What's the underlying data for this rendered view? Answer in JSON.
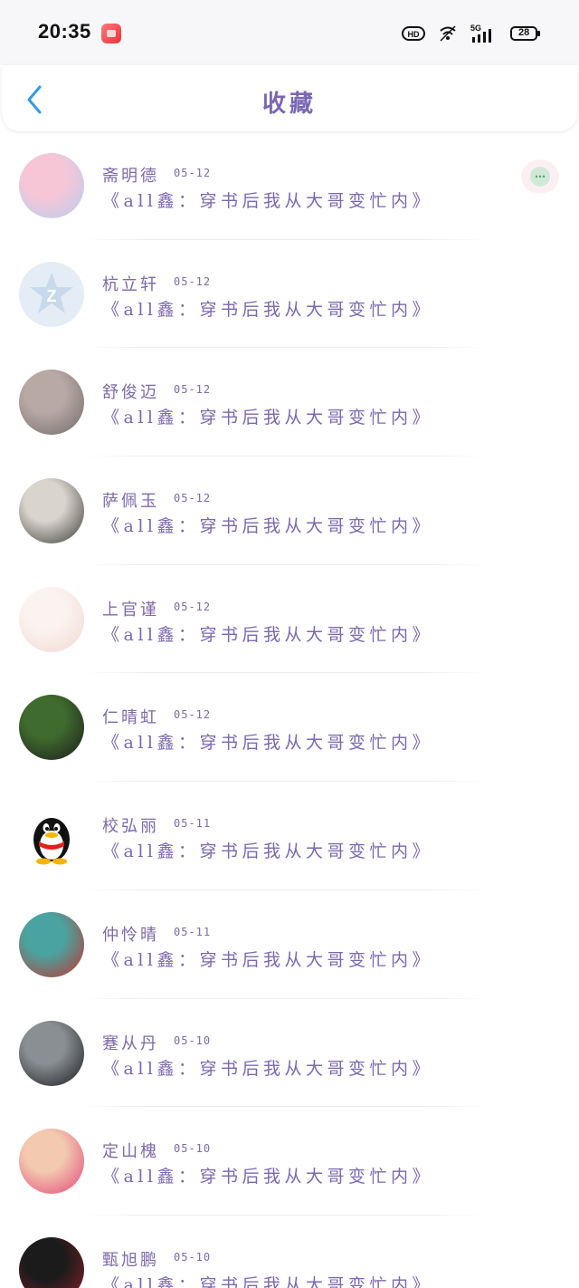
{
  "status_bar": {
    "time": "20:35",
    "battery": "28",
    "icons": [
      "app-icon",
      "hd-icon",
      "signal-icon",
      "network-5g-icon",
      "battery-icon"
    ]
  },
  "header": {
    "title": "收藏",
    "back_icon": "chevron-left-icon"
  },
  "floating_button": {
    "icon": "more-dots-icon",
    "label": "⋯"
  },
  "items": [
    {
      "name": "斋明德",
      "date": "05-12",
      "title": "《all鑫：穿书后我从大哥变忙内》",
      "avatar": {
        "kind": "photo",
        "colors": [
          "#f7c6d6",
          "#b9cdef"
        ]
      }
    },
    {
      "name": "杭立轩",
      "date": "05-12",
      "title": "《all鑫：穿书后我从大哥变忙内》",
      "avatar": {
        "kind": "badge",
        "icon": "z-star-badge-icon",
        "colors": [
          "#dbe7f4",
          "#eef3f9"
        ]
      }
    },
    {
      "name": "舒俊迈",
      "date": "05-12",
      "title": "《all鑫：穿书后我从大哥变忙内》",
      "avatar": {
        "kind": "photo",
        "colors": [
          "#b9a9a5",
          "#6f6a6a"
        ]
      }
    },
    {
      "name": "萨佩玉",
      "date": "05-12",
      "title": "《all鑫：穿书后我从大哥变忙内》",
      "avatar": {
        "kind": "photo",
        "colors": [
          "#d9d4cc",
          "#3a3a38"
        ]
      }
    },
    {
      "name": "上官谨",
      "date": "05-12",
      "title": "《all鑫：穿书后我从大哥变忙内》",
      "avatar": {
        "kind": "photo",
        "colors": [
          "#fbf3ef",
          "#f2d7d2"
        ]
      }
    },
    {
      "name": "仁晴虹",
      "date": "05-12",
      "title": "《all鑫：穿书后我从大哥变忙内》",
      "avatar": {
        "kind": "photo",
        "colors": [
          "#3f6b2e",
          "#1c1c1c"
        ]
      }
    },
    {
      "name": "校弘丽",
      "date": "05-11",
      "title": "《all鑫：穿书后我从大哥变忙内》",
      "avatar": {
        "kind": "badge",
        "icon": "qq-penguin-icon",
        "colors": [
          "#ffffff",
          "#ffffff"
        ]
      }
    },
    {
      "name": "仲怜晴",
      "date": "05-11",
      "title": "《all鑫：穿书后我从大哥变忙内》",
      "avatar": {
        "kind": "photo",
        "colors": [
          "#4aa3a0",
          "#c2322a"
        ]
      }
    },
    {
      "name": "蹇从丹",
      "date": "05-10",
      "title": "《all鑫：穿书后我从大哥变忙内》",
      "avatar": {
        "kind": "photo",
        "colors": [
          "#8a8f94",
          "#1a1a1a"
        ]
      }
    },
    {
      "name": "定山槐",
      "date": "05-10",
      "title": "《all鑫：穿书后我从大哥变忙内》",
      "avatar": {
        "kind": "photo",
        "colors": [
          "#f3c9b0",
          "#e3457a"
        ]
      }
    },
    {
      "name": "甄旭鹏",
      "date": "05-10",
      "title": "《all鑫：穿书后我从大哥变忙内》",
      "avatar": {
        "kind": "photo",
        "colors": [
          "#1b1b1b",
          "#8a1f2a"
        ]
      }
    }
  ],
  "colors": {
    "accent_purple": "#7b68b0",
    "back_blue": "#2f9be6"
  }
}
